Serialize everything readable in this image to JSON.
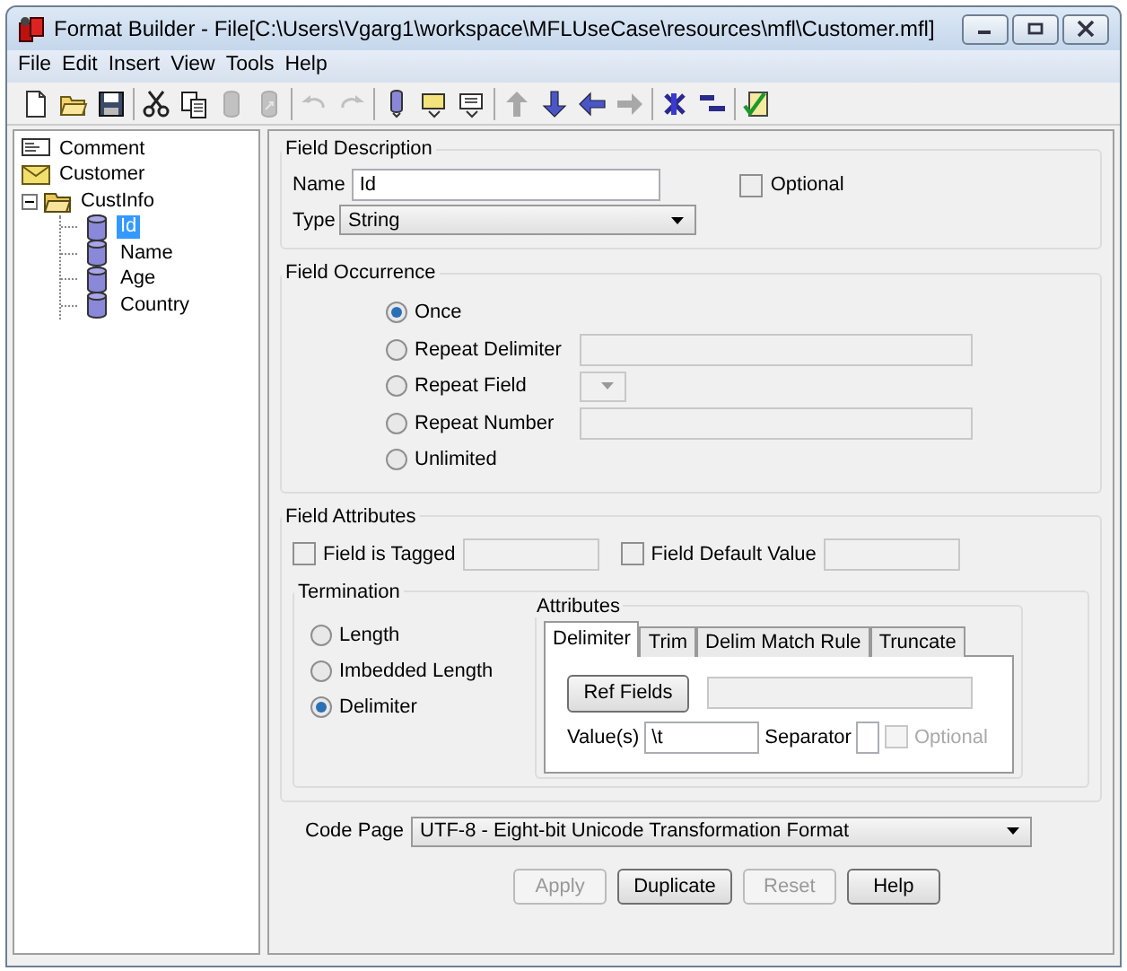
{
  "window": {
    "title": "Format Builder - File[C:\\Users\\Vgarg1\\workspace\\MFLUseCase\\resources\\mfl\\Customer.mfl]"
  },
  "menu": [
    "File",
    "Edit",
    "Insert",
    "View",
    "Tools",
    "Help"
  ],
  "toolbar": [
    {
      "items": [
        {
          "kind": "new",
          "disabled": false
        },
        {
          "kind": "open",
          "disabled": false
        },
        {
          "kind": "save",
          "disabled": false
        }
      ]
    },
    {
      "items": [
        {
          "kind": "cut",
          "disabled": false
        },
        {
          "kind": "copy",
          "disabled": false
        },
        {
          "kind": "cylinder",
          "disabled": true
        },
        {
          "kind": "cylinder-link",
          "disabled": true
        }
      ]
    },
    {
      "items": [
        {
          "kind": "undo",
          "disabled": true
        },
        {
          "kind": "redo",
          "disabled": true
        }
      ]
    },
    {
      "items": [
        {
          "kind": "field-add",
          "disabled": false
        },
        {
          "kind": "group-add",
          "disabled": false
        },
        {
          "kind": "comment-add",
          "disabled": false
        }
      ]
    },
    {
      "items": [
        {
          "kind": "up",
          "disabled": true
        },
        {
          "kind": "down",
          "disabled": false
        },
        {
          "kind": "left",
          "disabled": false
        },
        {
          "kind": "right",
          "disabled": true
        }
      ]
    },
    {
      "items": [
        {
          "kind": "expand",
          "disabled": false
        },
        {
          "kind": "collapse",
          "disabled": false
        }
      ]
    },
    {
      "items": [
        {
          "kind": "check",
          "disabled": false
        }
      ]
    }
  ],
  "tree": [
    {
      "label": "Comment",
      "kind": "comment",
      "selected": false
    },
    {
      "label": "Customer",
      "kind": "record",
      "selected": false
    },
    {
      "label": "CustInfo",
      "kind": "group",
      "selected": false,
      "expanded": true,
      "children": [
        {
          "label": "Id",
          "kind": "field",
          "selected": true
        },
        {
          "label": "Name",
          "kind": "field",
          "selected": false
        },
        {
          "label": "Age",
          "kind": "field",
          "selected": false
        },
        {
          "label": "Country",
          "kind": "field",
          "selected": false
        }
      ]
    }
  ],
  "field_description": {
    "title": "Field Description",
    "name_label": "Name",
    "name_value": "Id",
    "type_label": "Type",
    "type_value": "String",
    "optional": {
      "label": "Optional",
      "checked": false
    }
  },
  "field_occurrence": {
    "title": "Field Occurrence",
    "options": [
      {
        "label": "Once",
        "kind": "plain",
        "selected": true
      },
      {
        "label": "Repeat Delimiter",
        "kind": "text",
        "selected": false
      },
      {
        "label": "Repeat Field",
        "kind": "dropdown",
        "selected": false
      },
      {
        "label": "Repeat Number",
        "kind": "text",
        "selected": false
      },
      {
        "label": "Unlimited",
        "kind": "plain",
        "selected": false
      }
    ]
  },
  "field_attributes": {
    "title": "Field Attributes",
    "checks": [
      {
        "label": "Field is Tagged",
        "checked": false
      },
      {
        "label": "Field Default Value",
        "checked": false
      }
    ],
    "termination": {
      "title": "Termination",
      "options": [
        {
          "label": "Length",
          "selected": false
        },
        {
          "label": "Imbedded Length",
          "selected": false
        },
        {
          "label": "Delimiter",
          "selected": true
        }
      ],
      "attributes": {
        "title": "Attributes",
        "tabs": [
          {
            "label": "Delimiter",
            "selected": true
          },
          {
            "label": "Trim",
            "selected": false
          },
          {
            "label": "Delim Match Rule",
            "selected": false
          },
          {
            "label": "Truncate",
            "selected": false
          }
        ],
        "ref_fields_button": "Ref Fields",
        "values_label": "Value(s)",
        "values_value": "\\t",
        "separator_label": "Separator",
        "optional": {
          "label": "Optional",
          "checked": false,
          "disabled": true
        }
      }
    }
  },
  "code_page": {
    "label": "Code Page",
    "value": "UTF-8 - Eight-bit Unicode Transformation Format"
  },
  "buttons": [
    {
      "label": "Apply",
      "disabled": true
    },
    {
      "label": "Duplicate",
      "disabled": false
    },
    {
      "label": "Reset",
      "disabled": true
    },
    {
      "label": "Help",
      "disabled": false
    }
  ]
}
